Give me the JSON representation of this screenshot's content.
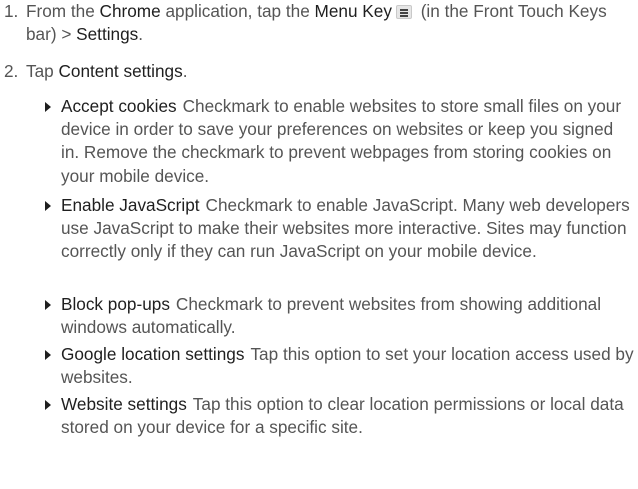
{
  "steps": [
    {
      "number": "1.",
      "prefix": "From the ",
      "app": "Chrome",
      "middle": " application, tap the ",
      "key": "Menu Key",
      "icon": "menu-key-icon",
      "after_key": " (in the Front Touch Keys bar) > ",
      "target": "Settings",
      "end": "."
    },
    {
      "number": "2.",
      "prefix": "Tap ",
      "target": "Content settings",
      "end": "."
    }
  ],
  "options": [
    {
      "term": "Accept cookies",
      "description": "Checkmark to enable websites to store small files on your device in order to save your preferences on websites or keep you signed in. Remove the checkmark to prevent webpages from storing cookies on your mobile device."
    },
    {
      "term": "Enable JavaScript",
      "description": "Checkmark to enable JavaScript. Many web developers use JavaScript to make their websites more interactive. Sites may function correctly only if they can run JavaScript on your mobile device."
    },
    {
      "term": "Block pop-ups",
      "description": "Checkmark to prevent websites from showing additional windows automatically."
    },
    {
      "term": "Google location settings",
      "description": "Tap this option to set your location access used by websites."
    },
    {
      "term": "Website settings",
      "description": "Tap this option to clear location permissions or local data stored on your device for a specific site."
    }
  ]
}
